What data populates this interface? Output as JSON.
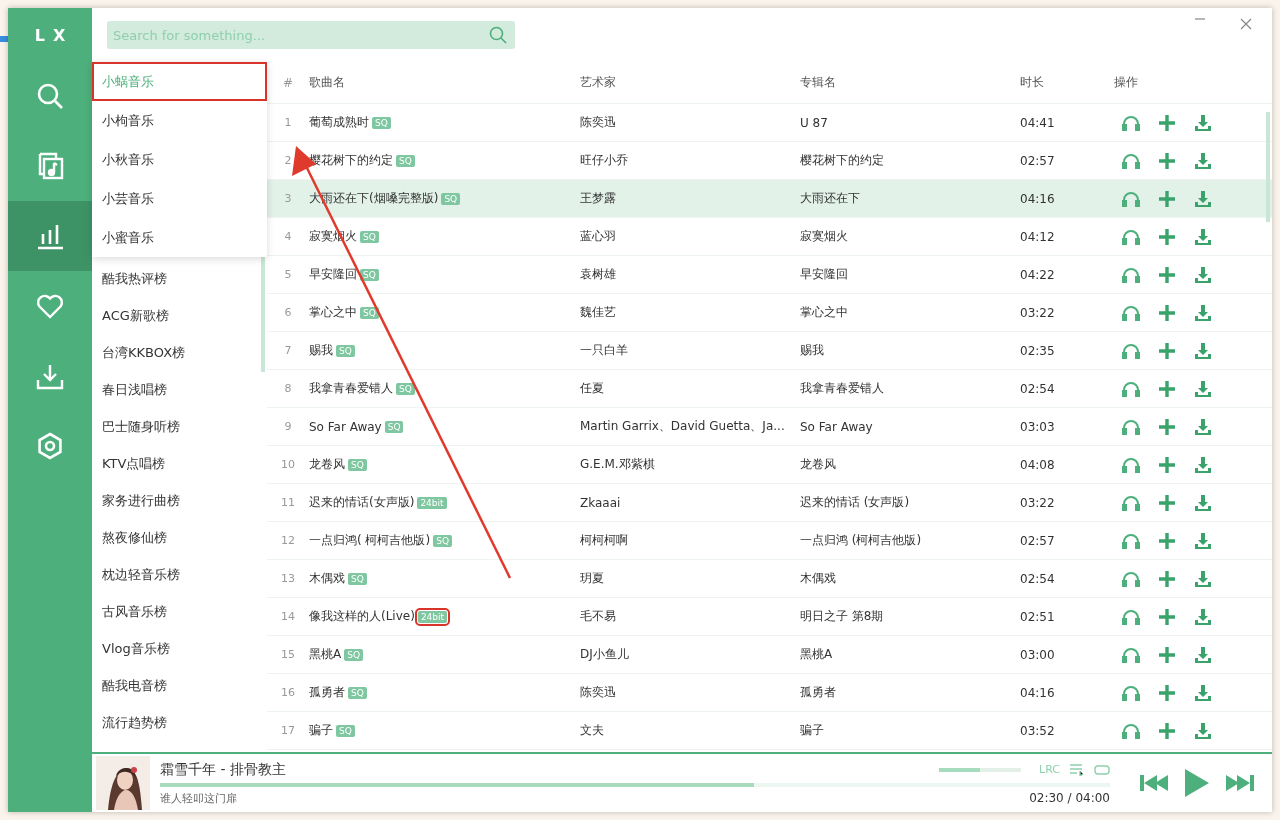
{
  "app": {
    "logo": "LX"
  },
  "nav": [
    {
      "kind": "search",
      "selected": false
    },
    {
      "kind": "list",
      "selected": false
    },
    {
      "kind": "chart",
      "selected": true
    },
    {
      "kind": "heart",
      "selected": false
    },
    {
      "kind": "download",
      "selected": false
    },
    {
      "kind": "settings",
      "selected": false
    }
  ],
  "search": {
    "placeholder": "Search for something..."
  },
  "source_menu": [
    {
      "label": "小蜗音乐",
      "selected": true,
      "marked": true
    },
    {
      "label": "小枸音乐",
      "selected": false,
      "marked": false
    },
    {
      "label": "小秋音乐",
      "selected": false,
      "marked": false
    },
    {
      "label": "小芸音乐",
      "selected": false,
      "marked": false
    },
    {
      "label": "小蜜音乐",
      "selected": false,
      "marked": false
    }
  ],
  "charts": [
    "酷我热评榜",
    "ACG新歌榜",
    "台湾KKBOX榜",
    "春日浅唱榜",
    "巴士随身听榜",
    "KTV点唱榜",
    "家务进行曲榜",
    "熬夜修仙榜",
    "枕边轻音乐榜",
    "古风音乐榜",
    "Vlog音乐榜",
    "酷我电音榜",
    "流行趋势榜"
  ],
  "table": {
    "columns": [
      "#",
      "歌曲名",
      "艺术家",
      "专辑名",
      "时长",
      "操作"
    ],
    "rows": [
      {
        "num": "1",
        "title": "葡萄成熟时",
        "tag": "SQ",
        "tag_marked": false,
        "artist": "陈奕迅",
        "album": "U 87",
        "duration": "04:41",
        "selected": false
      },
      {
        "num": "2",
        "title": "樱花树下的约定",
        "tag": "SQ",
        "tag_marked": false,
        "artist": "旺仔小乔",
        "album": "樱花树下的约定",
        "duration": "02:57",
        "selected": false
      },
      {
        "num": "3",
        "title": "大雨还在下(烟嗓完整版)",
        "tag": "SQ",
        "tag_marked": false,
        "artist": "王梦露",
        "album": "大雨还在下",
        "duration": "04:16",
        "selected": true
      },
      {
        "num": "4",
        "title": "寂寞烟火",
        "tag": "SQ",
        "tag_marked": false,
        "artist": "蓝心羽",
        "album": "寂寞烟火",
        "duration": "04:12",
        "selected": false
      },
      {
        "num": "5",
        "title": "早安隆回",
        "tag": "SQ",
        "tag_marked": false,
        "artist": "袁树雄",
        "album": "早安隆回",
        "duration": "04:22",
        "selected": false
      },
      {
        "num": "6",
        "title": "掌心之中",
        "tag": "SQ",
        "tag_marked": false,
        "artist": "魏佳艺",
        "album": "掌心之中",
        "duration": "03:22",
        "selected": false
      },
      {
        "num": "7",
        "title": "赐我",
        "tag": "SQ",
        "tag_marked": false,
        "artist": "一只白羊",
        "album": "赐我",
        "duration": "02:35",
        "selected": false
      },
      {
        "num": "8",
        "title": "我拿青春爱错人",
        "tag": "SQ",
        "tag_marked": false,
        "artist": "任夏",
        "album": "我拿青春爱错人",
        "duration": "02:54",
        "selected": false
      },
      {
        "num": "9",
        "title": "So Far Away",
        "tag": "SQ",
        "tag_marked": false,
        "artist": "Martin Garrix、David Guetta、Ja...",
        "album": "So Far Away",
        "duration": "03:03",
        "selected": false
      },
      {
        "num": "10",
        "title": "龙卷风",
        "tag": "SQ",
        "tag_marked": false,
        "artist": "G.E.M.邓紫棋",
        "album": "龙卷风",
        "duration": "04:08",
        "selected": false
      },
      {
        "num": "11",
        "title": "迟来的情话(女声版)",
        "tag": "24bit",
        "tag_marked": false,
        "artist": "Zkaaai",
        "album": "迟来的情话 (女声版)",
        "duration": "03:22",
        "selected": false
      },
      {
        "num": "12",
        "title": "一点归鸿( 柯柯吉他版)",
        "tag": "SQ",
        "tag_marked": false,
        "artist": "柯柯柯啊",
        "album": "一点归鸿 (柯柯吉他版)",
        "duration": "02:57",
        "selected": false
      },
      {
        "num": "13",
        "title": "木偶戏",
        "tag": "SQ",
        "tag_marked": false,
        "artist": "玥夏",
        "album": "木偶戏",
        "duration": "02:54",
        "selected": false
      },
      {
        "num": "14",
        "title": "像我这样的人(Live)",
        "tag": "24bit",
        "tag_marked": true,
        "artist": "毛不易",
        "album": "明日之子 第8期",
        "duration": "02:51",
        "selected": false
      },
      {
        "num": "15",
        "title": "黑桃A",
        "tag": "SQ",
        "tag_marked": false,
        "artist": "DJ小鱼儿",
        "album": "黑桃A",
        "duration": "03:00",
        "selected": false
      },
      {
        "num": "16",
        "title": "孤勇者",
        "tag": "SQ",
        "tag_marked": false,
        "artist": "陈奕迅",
        "album": "孤勇者",
        "duration": "04:16",
        "selected": false
      },
      {
        "num": "17",
        "title": "骗子",
        "tag": "SQ",
        "tag_marked": false,
        "artist": "文夫",
        "album": "骗子",
        "duration": "03:52",
        "selected": false
      }
    ]
  },
  "player": {
    "title": "霜雪千年 - 排骨教主",
    "subtitle": "谁人轻叩这门扉",
    "progress": {
      "level": 0.625
    },
    "volume": {
      "level": 0.5
    },
    "lyrics_button": "LRC",
    "time": "02:30 / 04:00"
  }
}
